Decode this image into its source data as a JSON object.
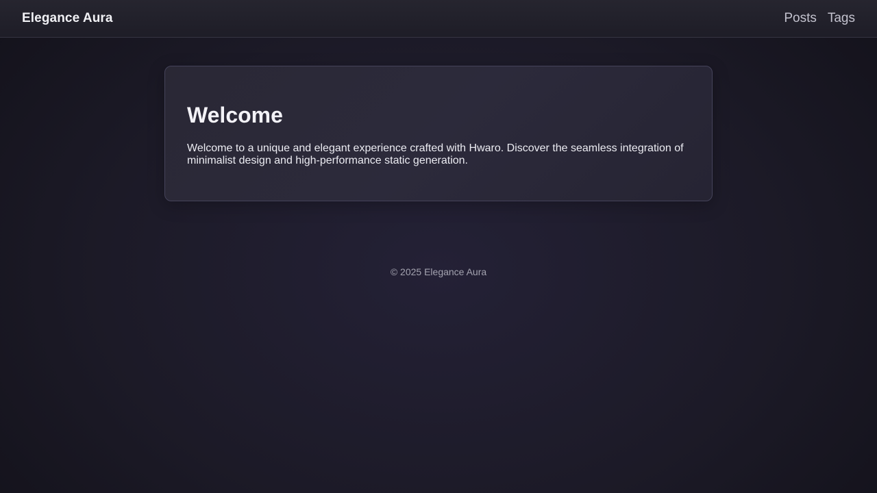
{
  "header": {
    "brand": "Elegance Aura",
    "nav": [
      {
        "label": "Posts"
      },
      {
        "label": "Tags"
      }
    ]
  },
  "main": {
    "title": "Welcome",
    "body": "Welcome to a unique and elegant experience crafted with Hwaro. Discover the seamless integration of minimalist design and high-performance static generation."
  },
  "footer": {
    "copyright": "© 2025 Elegance Aura"
  },
  "colors": {
    "background": "#1c1a27",
    "card_border": "#45435a",
    "text": "#ececf2",
    "muted_text": "#a4a3b0"
  }
}
